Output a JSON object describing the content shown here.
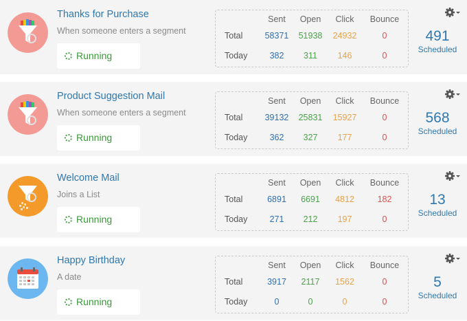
{
  "headers": {
    "sent": "Sent",
    "open": "Open",
    "click": "Click",
    "bounce": "Bounce"
  },
  "row_labels": {
    "total": "Total",
    "today": "Today"
  },
  "colors": {
    "link": "#2e78b0",
    "sent": "#2f6fb0",
    "open": "#4aa24a",
    "click": "#e8a24a",
    "bounce": "#d9534f"
  },
  "campaigns": [
    {
      "name": "Thanks for Purchase",
      "trigger": "When someone enters a segment",
      "status": "Running",
      "icon": "segment-funnel-icon",
      "total": {
        "sent": "58371",
        "open": "51938",
        "click": "24932",
        "bounce": "0"
      },
      "today": {
        "sent": "382",
        "open": "311",
        "click": "146",
        "bounce": "0"
      },
      "scheduled_count": "491",
      "scheduled_label": "Scheduled"
    },
    {
      "name": "Product Suggestion Mail",
      "trigger": "When someone enters a segment",
      "status": "Running",
      "icon": "segment-funnel-icon",
      "total": {
        "sent": "39132",
        "open": "25831",
        "click": "15927",
        "bounce": "0"
      },
      "today": {
        "sent": "362",
        "open": "327",
        "click": "177",
        "bounce": "0"
      },
      "scheduled_count": "568",
      "scheduled_label": "Scheduled"
    },
    {
      "name": "Welcome Mail",
      "trigger": "Joins a List",
      "status": "Running",
      "icon": "list-funnel-icon",
      "total": {
        "sent": "6891",
        "open": "6691",
        "click": "4812",
        "bounce": "182"
      },
      "today": {
        "sent": "271",
        "open": "212",
        "click": "197",
        "bounce": "0"
      },
      "scheduled_count": "13",
      "scheduled_label": "Scheduled"
    },
    {
      "name": "Happy Birthday",
      "trigger": "A date",
      "status": "Running",
      "icon": "calendar-icon",
      "total": {
        "sent": "3917",
        "open": "2117",
        "click": "1562",
        "bounce": "0"
      },
      "today": {
        "sent": "0",
        "open": "0",
        "click": "0",
        "bounce": "0"
      },
      "scheduled_count": "5",
      "scheduled_label": "Scheduled"
    }
  ]
}
